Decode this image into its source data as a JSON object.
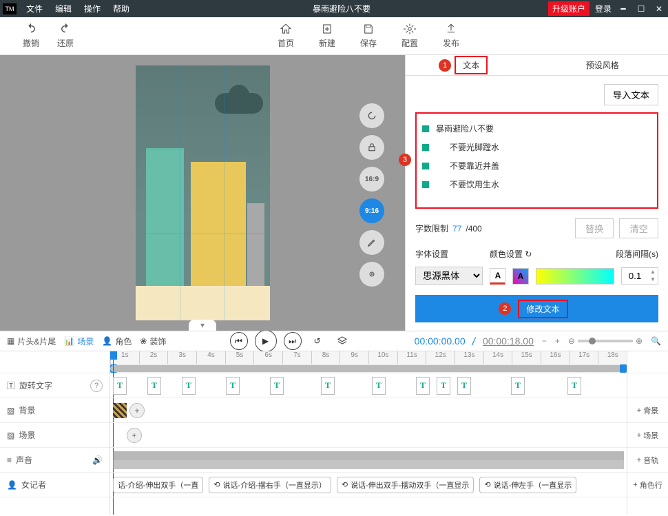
{
  "titlebar": {
    "logo": "TM",
    "menus": [
      "文件",
      "编辑",
      "操作",
      "帮助"
    ],
    "title": "暴雨避险八不要",
    "upgrade": "升级账户",
    "login": "登录"
  },
  "toolbar": {
    "undo": "撤销",
    "redo": "还原",
    "home": "首页",
    "new": "新建",
    "save": "保存",
    "config": "配置",
    "publish": "发布"
  },
  "canvas_controls": {
    "ratio1": "16:9",
    "ratio2": "9:16"
  },
  "sidepanel": {
    "tab_text": "文本",
    "tab_preset": "预设风格",
    "import": "导入文本",
    "text_items": [
      "暴雨避险八不要",
      "不要光脚蹚水",
      "不要靠近井盖",
      "不要饮用生水"
    ],
    "charcount_label": "字数限制",
    "charcount_cur": "77",
    "charcount_max": "/400",
    "replace": "替换",
    "clear": "清空",
    "font_label": "字体设置",
    "color_label": "颜色设置",
    "spacing_label": "段落间隔(s)",
    "font_value": "思源黑体",
    "spacing_value": "0.1",
    "modify": "修改文本"
  },
  "bottombar": {
    "clips": "片头&片尾",
    "scene": "场景",
    "role": "角色",
    "decor": "装饰",
    "time_cur": "00:00:00.00",
    "time_dur": "00:00:18.00"
  },
  "timeline": {
    "ruler_secs": [
      "1s",
      "2s",
      "3s",
      "4s",
      "5s",
      "6s",
      "7s",
      "8s",
      "9s",
      "10s",
      "11s",
      "12s",
      "13s",
      "14s",
      "15s",
      "16s",
      "17s",
      "18s"
    ],
    "tracks": {
      "text": "旋转文字",
      "bg": "背景",
      "scene": "场景",
      "audio": "声音",
      "reporter": "女记者"
    },
    "speech_clips": [
      "话-介绍-伸出双手（一直",
      "说话-介绍-摆右手（一直显示）",
      "说话-伸出双手-摆动双手（一直显示",
      "说话-伸左手（一直显示"
    ],
    "sidebtns": {
      "bg": "背景",
      "scene": "场景",
      "audio": "音轨",
      "role": "角色行"
    }
  },
  "markers": {
    "m1": "1",
    "m2": "2",
    "m3": "3"
  }
}
